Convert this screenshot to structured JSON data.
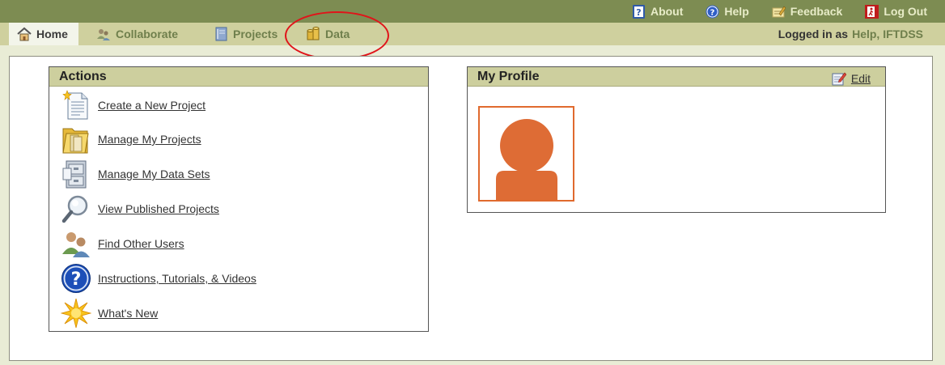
{
  "top_links": {
    "about": "About",
    "help": "Help",
    "feedback": "Feedback",
    "logout": "Log Out"
  },
  "tabs": {
    "home": "Home",
    "collaborate": "Collaborate",
    "projects": "Projects",
    "data": "Data"
  },
  "login": {
    "prefix": "Logged in as",
    "user": "Help, IFTDSS"
  },
  "actions_panel": {
    "title": "Actions",
    "items": [
      {
        "label": "Create a New Project",
        "icon": "new-document-icon"
      },
      {
        "label": "Manage My Projects",
        "icon": "folder-icon"
      },
      {
        "label": "Manage My Data Sets",
        "icon": "file-cabinet-icon"
      },
      {
        "label": "View Published Projects",
        "icon": "magnifier-icon"
      },
      {
        "label": "Find Other Users",
        "icon": "users-icon"
      },
      {
        "label": "Instructions, Tutorials, & Videos",
        "icon": "help-circle-icon"
      },
      {
        "label": "What's New",
        "icon": "starburst-icon"
      }
    ]
  },
  "profile_panel": {
    "title": "My Profile",
    "edit_label": "Edit"
  },
  "colors": {
    "top_bar": "#7d8c52",
    "tab_bar": "#cfd09e",
    "panel_header": "#cdcf9e",
    "avatar": "#de6c35",
    "highlight_circle": "#e0141a"
  }
}
